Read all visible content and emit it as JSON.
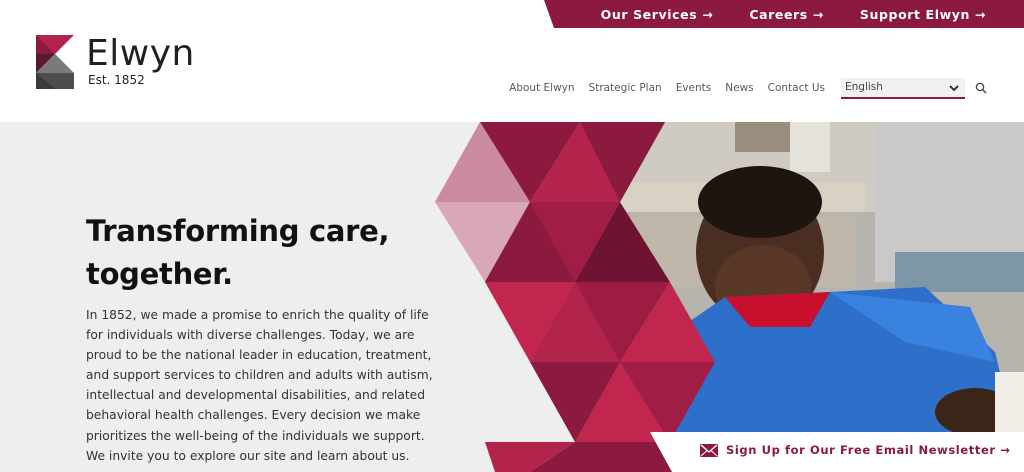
{
  "brand": {
    "name": "Elwyn",
    "established": "Est. 1852",
    "colors": {
      "maroon": "#8b1a3e",
      "crimson": "#c0264e",
      "rose": "#d9a8b6",
      "gray": "#4d4d4f"
    }
  },
  "utility_nav": [
    {
      "label": "Our Services →"
    },
    {
      "label": "Careers →"
    },
    {
      "label": "Support Elwyn →"
    }
  ],
  "main_nav": {
    "items": [
      {
        "label": "About Elwyn"
      },
      {
        "label": "Strategic Plan"
      },
      {
        "label": "Events"
      },
      {
        "label": "News"
      },
      {
        "label": "Contact Us"
      }
    ],
    "language": {
      "selected": "English"
    },
    "search_icon": "search-icon"
  },
  "hero": {
    "title_line1": "Transforming care,",
    "title_line2": "together.",
    "body": "In 1852, we made a promise to enrich the quality of life for individuals with diverse challenges. Today, we are proud to be the national leader in education, treatment, and support services to children and adults with autism, intellectual and developmental disabilities, and related behavioral health challenges. Every decision we make prioritizes the well-being of the individuals we support. We invite you to explore our site and learn about us."
  },
  "newsletter": {
    "label": "Sign Up for Our Free Email Newsletter →",
    "icon": "envelope-icon"
  }
}
